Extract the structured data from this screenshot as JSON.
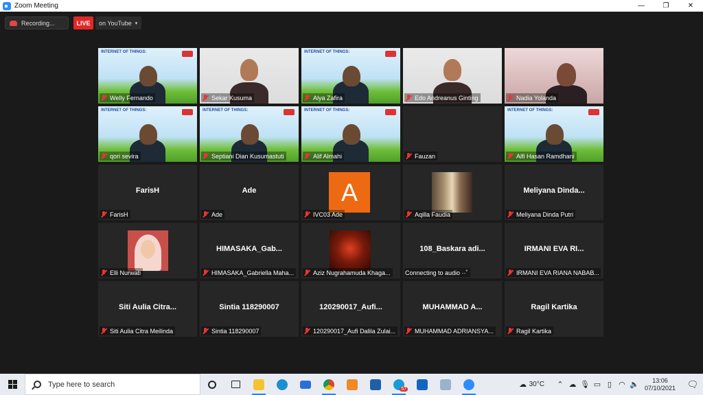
{
  "window": {
    "title": "Zoom Meeting",
    "minimize": "—",
    "restore": "❐",
    "close": "✕"
  },
  "toolbar": {
    "recording": "Recording...",
    "live": "LIVE",
    "youtube": "on YouTube",
    "caret": "▾"
  },
  "participants": [
    {
      "label": "Welly Fernando",
      "type": "banner",
      "banner_title": "INTERNET OF THINGS:"
    },
    {
      "label": "Sekar Kusuma",
      "type": "room"
    },
    {
      "label": "Alya Zafira",
      "type": "banner",
      "banner_title": "INTERNET OF THINGS:"
    },
    {
      "label": "Edo Andreanus Ginting",
      "type": "room"
    },
    {
      "label": "Nadia Yolanda",
      "type": "pink"
    },
    {
      "label": "qori sevira",
      "type": "banner",
      "banner_title": "INTERNET OF THINGS:"
    },
    {
      "label": "Septiani Dian Kusumastuti",
      "type": "banner",
      "banner_title": "INTERNET OF THINGS:"
    },
    {
      "label": "Alif Almahi",
      "type": "banner",
      "banner_title": "INTERNET OF THINGS:"
    },
    {
      "label": "Fauzan",
      "type": "empty"
    },
    {
      "label": "Alfi Hasan Ramdhani",
      "type": "banner",
      "banner_title": "INTERNET OF THINGS:"
    },
    {
      "label": "FarisH",
      "type": "name",
      "display_name": "FarisH"
    },
    {
      "label": "Ade",
      "type": "name",
      "display_name": "Ade"
    },
    {
      "label": "IVC03 Ade",
      "type": "avatar",
      "avatar_letter": "A"
    },
    {
      "label": "Aqilla Faudia",
      "type": "photo-city"
    },
    {
      "label": "Meliyana Dinda Putri",
      "type": "name",
      "display_name": "Meliyana  Dinda..."
    },
    {
      "label": "Elli Nurwati",
      "type": "photo-hijab"
    },
    {
      "label": "HIMASAKA_Gabriella Maha...",
      "type": "name",
      "display_name": "HIMASAKA_Gab..."
    },
    {
      "label": "Aziz Nugrahamuda Khaga...",
      "type": "photo-game"
    },
    {
      "label": "Connecting to audio ··˚",
      "type": "name",
      "display_name": "108_Baskara  adi...",
      "no_mic": true
    },
    {
      "label": "IRMANI EVA RIANA NABAB...",
      "type": "name",
      "display_name": "IRMANI EVA RI..."
    },
    {
      "label": "Siti Aulia Citra Meilinda",
      "type": "name",
      "display_name": "Siti  Aulia  Citra..."
    },
    {
      "label": "Sintia 118290007",
      "type": "name",
      "display_name": "Sintia 118290007"
    },
    {
      "label": "120290017_Aufi Dalila Zulai...",
      "type": "name",
      "display_name": "120290017_Aufi..."
    },
    {
      "label": "MUHAMMAD ADRIANSYA...",
      "type": "name",
      "display_name": "MUHAMMAD  A..."
    },
    {
      "label": "Ragil Kartika",
      "type": "name",
      "display_name": "Ragil Kartika"
    }
  ],
  "taskbar": {
    "search_placeholder": "Type here to search",
    "mail_badge": "57",
    "temperature": "30°C",
    "time": "13:06",
    "date": "07/10/2021"
  }
}
